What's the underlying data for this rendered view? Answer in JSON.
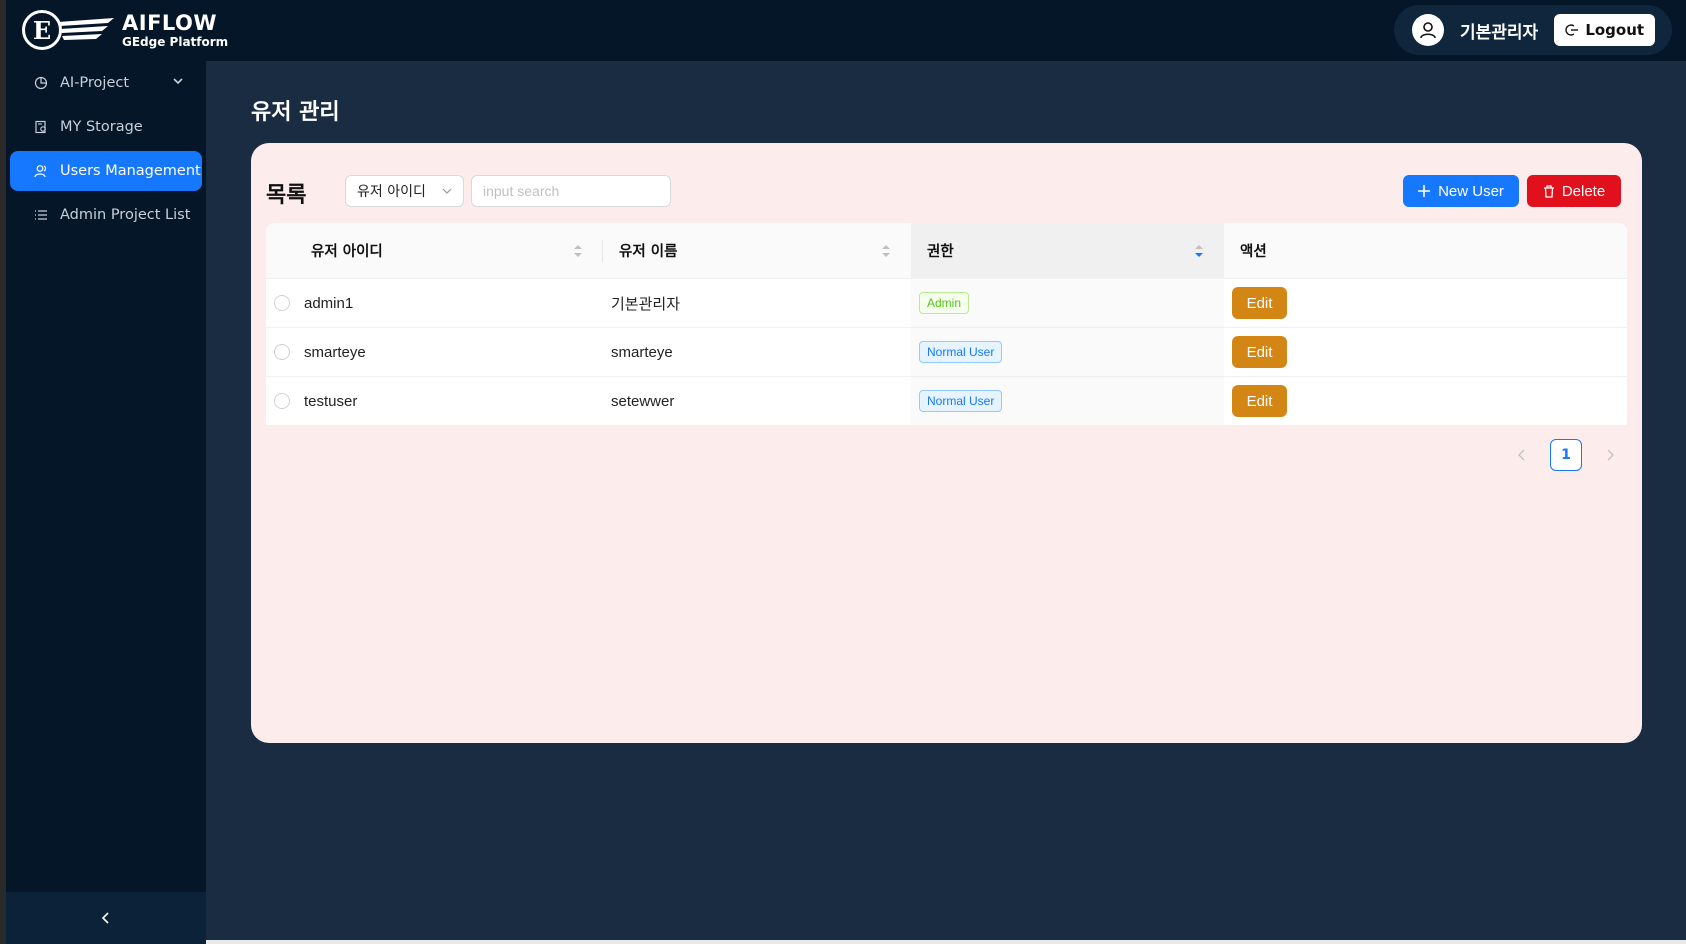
{
  "app": {
    "logo_mark": "E",
    "logo_title": "AIFLOW",
    "logo_subtitle": "GEdge Platform"
  },
  "header": {
    "username": "기본관리자",
    "logout_label": "Logout"
  },
  "sidebar": {
    "items": [
      {
        "label": "AI-Project",
        "icon": "pie-chart-icon",
        "expandable": true
      },
      {
        "label": "MY Storage",
        "icon": "storage-icon"
      },
      {
        "label": "Users Management",
        "icon": "users-icon",
        "active": true
      },
      {
        "label": "Admin Project List",
        "icon": "list-icon"
      }
    ],
    "collapse_icon": "chevron-left-icon"
  },
  "page": {
    "title": "유저 관리"
  },
  "list": {
    "title": "목록",
    "search_field": "유저 아이디",
    "search_placeholder": "input search",
    "new_user_label": "New User",
    "delete_label": "Delete"
  },
  "table": {
    "columns": [
      "유저 아이디",
      "유저 이름",
      "권한",
      "액션"
    ],
    "rows": [
      {
        "user_id": "admin1",
        "user_name": "기본관리자",
        "role": "Admin",
        "action": "Edit"
      },
      {
        "user_id": "smarteye",
        "user_name": "smarteye",
        "role": "Normal User",
        "action": "Edit"
      },
      {
        "user_id": "testuser",
        "user_name": "setewwer",
        "role": "Normal User",
        "action": "Edit"
      }
    ]
  },
  "pagination": {
    "current_page": "1"
  },
  "colors": {
    "primary": "#1677ff",
    "danger": "#e0101d",
    "edit": "#d48614",
    "sidebar_bg": "#041628",
    "main_bg": "#1a2c41",
    "card_bg": "#fdecec"
  }
}
